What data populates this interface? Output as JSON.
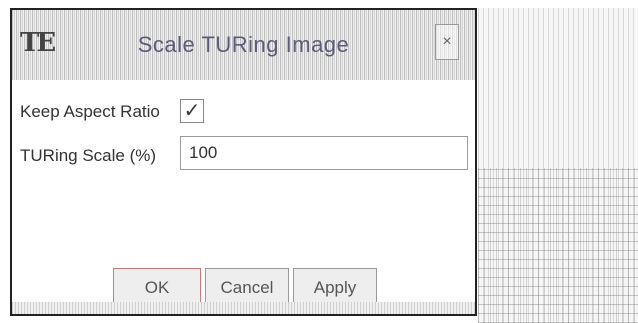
{
  "window": {
    "title": "Scale TURing Image",
    "close_glyph": "×",
    "app_icon": "app-logo-icon"
  },
  "form": {
    "keep_aspect_label": "Keep Aspect Ratio",
    "keep_aspect_checked": true,
    "check_glyph": "✓",
    "scale_label": "TURing Scale (%)",
    "scale_value": "100"
  },
  "buttons": {
    "ok": "OK",
    "cancel": "Cancel",
    "apply": "Apply"
  }
}
